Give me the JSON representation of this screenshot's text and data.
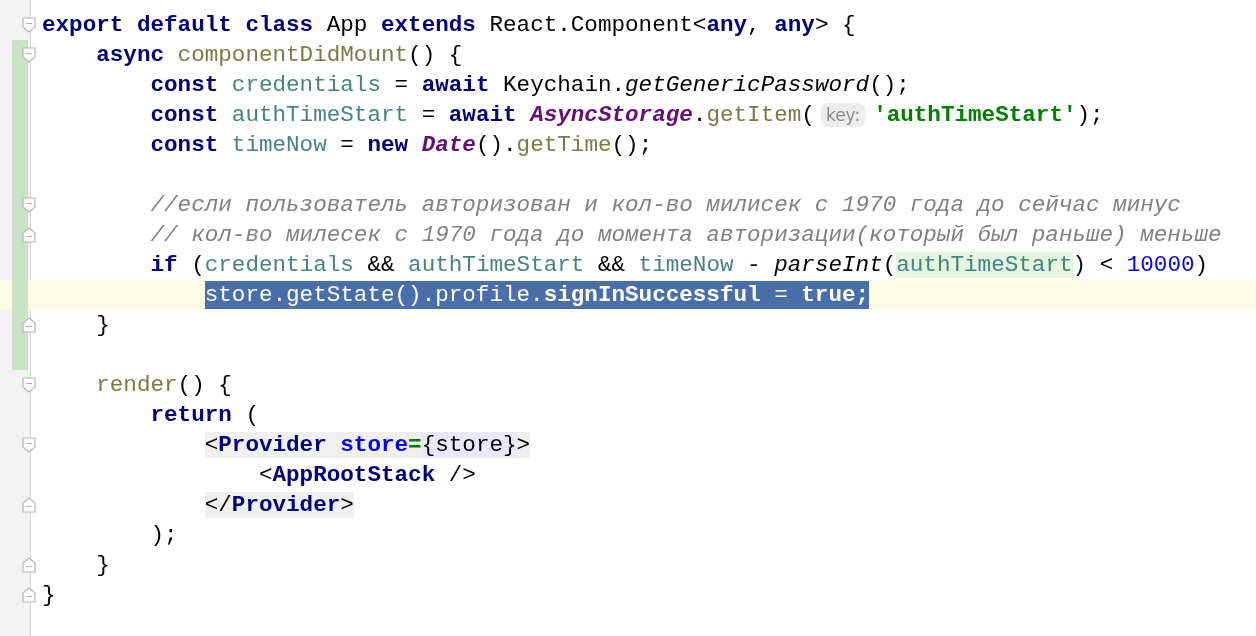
{
  "editor": {
    "lines": [
      {
        "fold_open": true,
        "fold_close": false,
        "changed": false,
        "current": false,
        "parts": [
          {
            "kind": "code",
            "selected": false,
            "tokens": [
              {
                "text": "export ",
                "kind": "keyword"
              },
              {
                "text": "default ",
                "kind": "keyword"
              },
              {
                "text": "class ",
                "kind": "keyword"
              },
              {
                "text": "App ",
                "kind": "plain"
              },
              {
                "text": "extends",
                "kind": "keyword"
              },
              {
                "text": " React.Component<",
                "kind": "plain"
              },
              {
                "text": "any",
                "kind": "keyword"
              },
              {
                "text": ", ",
                "kind": "plain"
              },
              {
                "text": "any",
                "kind": "keyword"
              },
              {
                "text": "> {",
                "kind": "plain"
              }
            ]
          }
        ]
      },
      {
        "fold_open": true,
        "fold_close": false,
        "changed": true,
        "current": false,
        "parts": [
          {
            "kind": "code",
            "selected": false,
            "tokens": [
              {
                "text": "    async ",
                "kind": "keyword"
              },
              {
                "text": "componentDidMount",
                "kind": "function"
              },
              {
                "text": "() {",
                "kind": "plain"
              }
            ]
          }
        ]
      },
      {
        "fold_open": false,
        "fold_close": false,
        "changed": true,
        "current": false,
        "parts": [
          {
            "kind": "code",
            "selected": false,
            "tokens": [
              {
                "text": "        const ",
                "kind": "keyword"
              },
              {
                "text": "credentials",
                "kind": "variable"
              },
              {
                "text": " = ",
                "kind": "plain"
              },
              {
                "text": "await",
                "kind": "keyword"
              },
              {
                "text": " Keychain.",
                "kind": "plain"
              },
              {
                "text": "getGenericPassword",
                "kind": "italic"
              },
              {
                "text": "();",
                "kind": "plain"
              }
            ]
          }
        ]
      },
      {
        "fold_open": false,
        "fold_close": false,
        "changed": true,
        "current": false,
        "parts": [
          {
            "kind": "code",
            "selected": false,
            "tokens": [
              {
                "text": "        const ",
                "kind": "keyword"
              },
              {
                "text": "authTimeStart",
                "kind": "variable"
              },
              {
                "text": " = ",
                "kind": "plain"
              },
              {
                "text": "await ",
                "kind": "keyword"
              },
              {
                "text": "AsyncStorage",
                "kind": "class"
              },
              {
                "text": ".",
                "kind": "plain"
              },
              {
                "text": "getItem",
                "kind": "function"
              },
              {
                "text": "(",
                "kind": "plain"
              }
            ]
          },
          {
            "kind": "hint",
            "text": "key:"
          },
          {
            "kind": "code",
            "selected": false,
            "tokens": [
              {
                "text": "'authTimeStart'",
                "kind": "string"
              },
              {
                "text": ");",
                "kind": "plain"
              }
            ]
          }
        ]
      },
      {
        "fold_open": false,
        "fold_close": false,
        "changed": true,
        "current": false,
        "parts": [
          {
            "kind": "code",
            "selected": false,
            "tokens": [
              {
                "text": "        const ",
                "kind": "keyword"
              },
              {
                "text": "timeNow",
                "kind": "variable"
              },
              {
                "text": " = ",
                "kind": "plain"
              },
              {
                "text": "new ",
                "kind": "keyword"
              },
              {
                "text": "Date",
                "kind": "class"
              },
              {
                "text": "().",
                "kind": "plain"
              },
              {
                "text": "getTime",
                "kind": "function"
              },
              {
                "text": "();",
                "kind": "plain"
              }
            ]
          }
        ]
      },
      {
        "fold_open": false,
        "fold_close": false,
        "changed": true,
        "current": false
      },
      {
        "fold_open": true,
        "fold_close": false,
        "changed": true,
        "current": false,
        "parts": [
          {
            "kind": "code",
            "selected": false,
            "tokens": [
              {
                "text": "        //если пользователь авторизован и кол-во милисек с 1970 года до сейчас минус",
                "kind": "comment"
              }
            ]
          }
        ]
      },
      {
        "fold_open": false,
        "fold_close": true,
        "changed": true,
        "current": false,
        "parts": [
          {
            "kind": "code",
            "selected": false,
            "tokens": [
              {
                "text": "        // кол-во милесек с 1970 года до момента авторизации(который был раньше) меньше",
                "kind": "comment"
              }
            ]
          }
        ]
      },
      {
        "fold_open": false,
        "fold_close": false,
        "changed": true,
        "current": false,
        "parts": [
          {
            "kind": "code",
            "selected": false,
            "tokens": [
              {
                "text": "        if",
                "kind": "keyword"
              },
              {
                "text": " (",
                "kind": "plain"
              },
              {
                "text": "credentials",
                "kind": "variable"
              },
              {
                "text": " && ",
                "kind": "plain"
              },
              {
                "text": "authTimeStart",
                "kind": "variable"
              },
              {
                "text": " && ",
                "kind": "plain"
              },
              {
                "text": "timeNow",
                "kind": "variable"
              },
              {
                "text": " - ",
                "kind": "plain"
              },
              {
                "text": "parseInt",
                "kind": "italic"
              },
              {
                "text": "(",
                "kind": "plain"
              },
              {
                "text": "authTimeStart",
                "kind": "usage"
              },
              {
                "text": ") < ",
                "kind": "plain"
              },
              {
                "text": "10000",
                "kind": "number"
              },
              {
                "text": ")",
                "kind": "plain"
              }
            ]
          }
        ]
      },
      {
        "fold_open": false,
        "fold_close": false,
        "changed": true,
        "current": true,
        "parts": [
          {
            "kind": "code",
            "selected": true,
            "tokens": [
              {
                "text": "            store.getState().profile.",
                "kind": "plain"
              },
              {
                "text": "signInSuccessful",
                "kind": "bold"
              },
              {
                "text": " = ",
                "kind": "plain"
              },
              {
                "text": "true",
                "kind": "keyword"
              },
              {
                "text": ";",
                "kind": "bold"
              }
            ]
          }
        ]
      },
      {
        "fold_open": false,
        "fold_close": true,
        "changed": true,
        "current": false,
        "parts": [
          {
            "kind": "code",
            "selected": false,
            "tokens": [
              {
                "text": "    }",
                "kind": "plain"
              }
            ]
          }
        ]
      },
      {
        "fold_open": false,
        "fold_close": false,
        "changed": true,
        "current": false
      },
      {
        "fold_open": true,
        "fold_close": false,
        "changed": false,
        "current": false,
        "parts": [
          {
            "kind": "code",
            "selected": false,
            "tokens": [
              {
                "text": "    render",
                "kind": "function"
              },
              {
                "text": "() {",
                "kind": "plain"
              }
            ]
          }
        ]
      },
      {
        "fold_open": false,
        "fold_close": false,
        "changed": false,
        "current": false,
        "parts": [
          {
            "kind": "code",
            "selected": false,
            "tokens": [
              {
                "text": "        return",
                "kind": "keyword"
              },
              {
                "text": " (",
                "kind": "plain"
              }
            ]
          }
        ]
      },
      {
        "fold_open": true,
        "fold_close": false,
        "changed": false,
        "current": false,
        "parts": [
          {
            "kind": "code",
            "selected": false,
            "tokens": [
              {
                "text": "            <",
                "kind": "tag-punct"
              },
              {
                "text": "Provider ",
                "kind": "tag-name"
              },
              {
                "text": "store",
                "kind": "attribute"
              },
              {
                "text": "=",
                "kind": "equals"
              },
              {
                "text": "{store}",
                "kind": "expression"
              },
              {
                "text": ">",
                "kind": "tag-punct"
              }
            ]
          }
        ]
      },
      {
        "fold_open": false,
        "fold_close": false,
        "changed": false,
        "current": false,
        "parts": [
          {
            "kind": "code",
            "selected": false,
            "tokens": [
              {
                "text": "                <",
                "kind": "plain"
              },
              {
                "text": "AppRootStack",
                "kind": "component"
              },
              {
                "text": " />",
                "kind": "plain"
              }
            ]
          }
        ]
      },
      {
        "fold_open": false,
        "fold_close": true,
        "changed": false,
        "current": false,
        "parts": [
          {
            "kind": "code",
            "selected": false,
            "tokens": [
              {
                "text": "            </",
                "kind": "tag-punct"
              },
              {
                "text": "Provider",
                "kind": "tag-name"
              },
              {
                "text": ">",
                "kind": "tag-punct"
              }
            ]
          }
        ]
      },
      {
        "fold_open": false,
        "fold_close": false,
        "changed": false,
        "current": false,
        "parts": [
          {
            "kind": "code",
            "selected": false,
            "tokens": [
              {
                "text": "        );",
                "kind": "plain"
              }
            ]
          }
        ]
      },
      {
        "fold_open": false,
        "fold_close": true,
        "changed": false,
        "current": false,
        "parts": [
          {
            "kind": "code",
            "selected": false,
            "tokens": [
              {
                "text": "    }",
                "kind": "plain"
              }
            ]
          }
        ]
      },
      {
        "fold_open": false,
        "fold_close": true,
        "changed": false,
        "current": false,
        "parts": [
          {
            "kind": "code",
            "selected": false,
            "tokens": [
              {
                "text": "}",
                "kind": "plain"
              }
            ]
          }
        ]
      }
    ]
  }
}
